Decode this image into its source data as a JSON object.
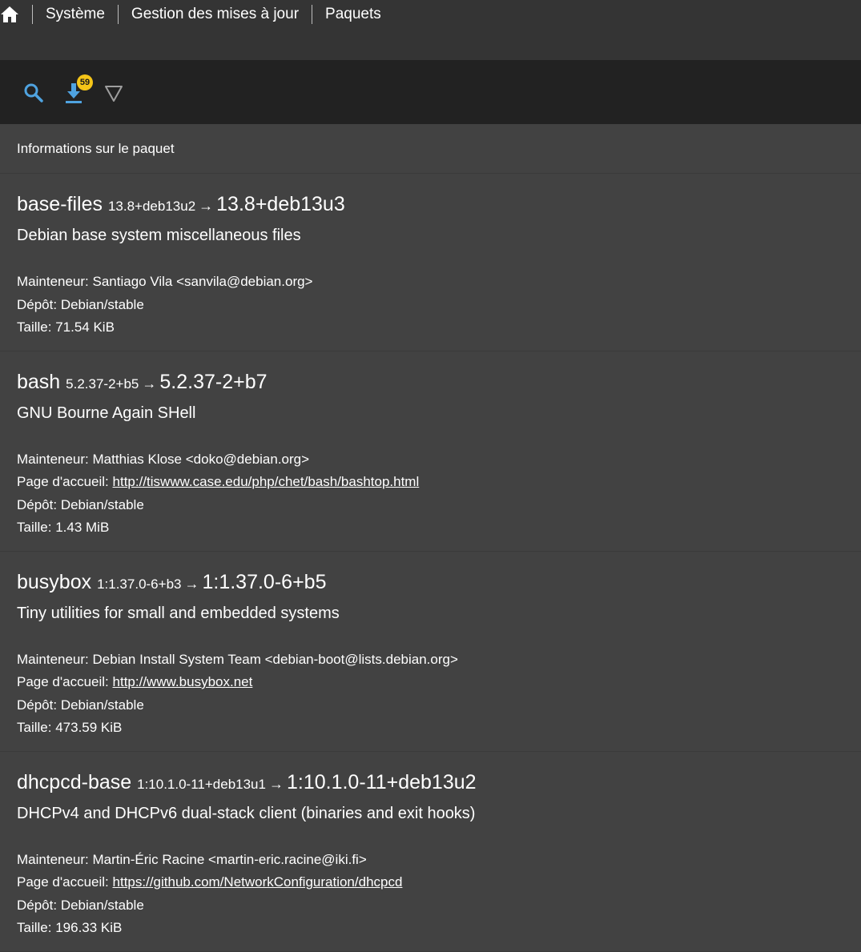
{
  "breadcrumb": {
    "items": [
      "Système",
      "Gestion des mises à jour",
      "Paquets"
    ]
  },
  "toolbar": {
    "search_icon": "search-icon",
    "download_icon": "download-icon",
    "download_badge": "59",
    "filter_icon": "filter-icon",
    "accent_color": "#4fa3e0",
    "badge_color": "#f5c518"
  },
  "section": {
    "title": "Informations sur le paquet"
  },
  "labels": {
    "maintainer": "Mainteneur:",
    "homepage": "Page d'accueil:",
    "repository": "Dépôt:",
    "size": "Taille:",
    "arrow": "→"
  },
  "packages": [
    {
      "name": "base-files",
      "old_version": "13.8+deb13u2",
      "new_version": "13.8+deb13u3",
      "description": "Debian base system miscellaneous files",
      "maintainer": "Santiago Vila <sanvila@debian.org>",
      "homepage": "",
      "repository": "Debian/stable",
      "size": "71.54 KiB"
    },
    {
      "name": "bash",
      "old_version": "5.2.37-2+b5",
      "new_version": "5.2.37-2+b7",
      "description": "GNU Bourne Again SHell",
      "maintainer": "Matthias Klose <doko@debian.org>",
      "homepage": "http://tiswww.case.edu/php/chet/bash/bashtop.html",
      "repository": "Debian/stable",
      "size": "1.43 MiB"
    },
    {
      "name": "busybox",
      "old_version": "1:1.37.0-6+b3",
      "new_version": "1:1.37.0-6+b5",
      "description": "Tiny utilities for small and embedded systems",
      "maintainer": "Debian Install System Team <debian-boot@lists.debian.org>",
      "homepage": "http://www.busybox.net",
      "repository": "Debian/stable",
      "size": "473.59 KiB"
    },
    {
      "name": "dhcpcd-base",
      "old_version": "1:10.1.0-11+deb13u1",
      "new_version": "1:10.1.0-11+deb13u2",
      "description": "DHCPv4 and DHCPv6 dual-stack client (binaries and exit hooks)",
      "maintainer": "Martin-Éric Racine <martin-eric.racine@iki.fi>",
      "homepage": "https://github.com/NetworkConfiguration/dhcpcd",
      "repository": "Debian/stable",
      "size": "196.33 KiB"
    }
  ]
}
